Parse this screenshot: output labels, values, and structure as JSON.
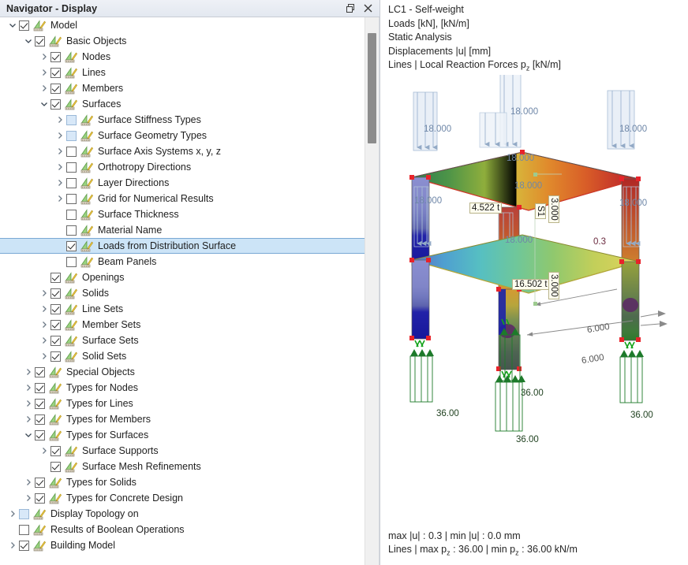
{
  "navigator": {
    "title": "Navigator - Display",
    "window_buttons": [
      {
        "name": "float-window-icon",
        "glyph": "restore"
      },
      {
        "name": "close-icon",
        "glyph": "close"
      }
    ],
    "tree": [
      {
        "depth": 0,
        "twisty": "down",
        "check": "checked",
        "label": "Model"
      },
      {
        "depth": 1,
        "twisty": "down",
        "check": "checked",
        "label": "Basic Objects"
      },
      {
        "depth": 2,
        "twisty": "right",
        "check": "checked",
        "label": "Nodes"
      },
      {
        "depth": 2,
        "twisty": "right",
        "check": "checked",
        "label": "Lines"
      },
      {
        "depth": 2,
        "twisty": "right",
        "check": "checked",
        "label": "Members"
      },
      {
        "depth": 2,
        "twisty": "down",
        "check": "checked",
        "label": "Surfaces"
      },
      {
        "depth": 3,
        "twisty": "right",
        "check": "light",
        "label": "Surface Stiffness Types"
      },
      {
        "depth": 3,
        "twisty": "right",
        "check": "light",
        "label": "Surface Geometry Types"
      },
      {
        "depth": 3,
        "twisty": "right",
        "check": "unchecked",
        "label": "Surface Axis Systems x, y, z"
      },
      {
        "depth": 3,
        "twisty": "right",
        "check": "unchecked",
        "label": "Orthotropy Directions"
      },
      {
        "depth": 3,
        "twisty": "right",
        "check": "unchecked",
        "label": "Layer Directions"
      },
      {
        "depth": 3,
        "twisty": "right",
        "check": "unchecked",
        "label": "Grid for Numerical Results"
      },
      {
        "depth": 3,
        "twisty": "none",
        "check": "unchecked",
        "label": "Surface Thickness"
      },
      {
        "depth": 3,
        "twisty": "none",
        "check": "unchecked",
        "label": "Material Name"
      },
      {
        "depth": 3,
        "twisty": "none",
        "check": "checked",
        "label": "Loads from Distribution Surface",
        "selected": true
      },
      {
        "depth": 3,
        "twisty": "none",
        "check": "unchecked",
        "label": "Beam Panels"
      },
      {
        "depth": 2,
        "twisty": "none",
        "check": "checked",
        "label": "Openings"
      },
      {
        "depth": 2,
        "twisty": "right",
        "check": "checked",
        "label": "Solids"
      },
      {
        "depth": 2,
        "twisty": "right",
        "check": "checked",
        "label": "Line Sets"
      },
      {
        "depth": 2,
        "twisty": "right",
        "check": "checked",
        "label": "Member Sets"
      },
      {
        "depth": 2,
        "twisty": "right",
        "check": "checked",
        "label": "Surface Sets"
      },
      {
        "depth": 2,
        "twisty": "right",
        "check": "checked",
        "label": "Solid Sets"
      },
      {
        "depth": 1,
        "twisty": "right",
        "check": "checked",
        "label": "Special Objects"
      },
      {
        "depth": 1,
        "twisty": "right",
        "check": "checked",
        "label": "Types for Nodes"
      },
      {
        "depth": 1,
        "twisty": "right",
        "check": "checked",
        "label": "Types for Lines"
      },
      {
        "depth": 1,
        "twisty": "right",
        "check": "checked",
        "label": "Types for Members"
      },
      {
        "depth": 1,
        "twisty": "down",
        "check": "checked",
        "label": "Types for Surfaces"
      },
      {
        "depth": 2,
        "twisty": "right",
        "check": "checked",
        "label": "Surface Supports"
      },
      {
        "depth": 2,
        "twisty": "none",
        "check": "checked",
        "label": "Surface Mesh Refinements"
      },
      {
        "depth": 1,
        "twisty": "right",
        "check": "checked",
        "label": "Types for Solids"
      },
      {
        "depth": 1,
        "twisty": "right",
        "check": "checked",
        "label": "Types for Concrete Design"
      },
      {
        "depth": 0,
        "twisty": "right",
        "check": "light",
        "label": "Display Topology on"
      },
      {
        "depth": 0,
        "twisty": "none",
        "check": "unchecked",
        "label": "Results of Boolean Operations"
      },
      {
        "depth": 0,
        "twisty": "right",
        "check": "checked",
        "label": "Building Model"
      }
    ]
  },
  "view": {
    "header_lines": [
      "LC1 - Self-weight",
      "Loads [kN], [kN/m]",
      "Static Analysis",
      "Displacements |u| [mm]"
    ],
    "header_last_prefix": "Lines | Local Reaction Forces p",
    "header_last_sub": "z",
    "header_last_suffix": " [kN/m]",
    "footer_line1": "max |u| : 0.3 | min |u| : 0.0 mm",
    "footer_line2_a": "Lines  | max p",
    "footer_line2_sub1": "z",
    "footer_line2_b": " : 36.00 | min p",
    "footer_line2_sub2": "z",
    "footer_line2_c": " : 36.00 kN/m",
    "colors": {
      "load_arrow": "#8fa8c4",
      "reaction_green": "#1d7a2a",
      "node_red": "#e8232a",
      "dimension_gray": "#7a7a7a",
      "selection_blue": "#cce4f7"
    },
    "annotations": {
      "load_labels": [
        "18.000",
        "18.000",
        "18.000",
        "18.000",
        "18.000",
        "18.000",
        "18.000",
        "18.000"
      ],
      "reaction_labels": [
        "36.00",
        "36.00",
        "36.00",
        "36.00"
      ],
      "dimension_labels": [
        "6.000",
        "6.000"
      ],
      "height_labels": [
        "3.000",
        "3.000"
      ],
      "surface_tag": "S1",
      "mass_upper": "4.522 t",
      "mass_lower": "16.502 t",
      "displacement_value": "0.3"
    }
  }
}
